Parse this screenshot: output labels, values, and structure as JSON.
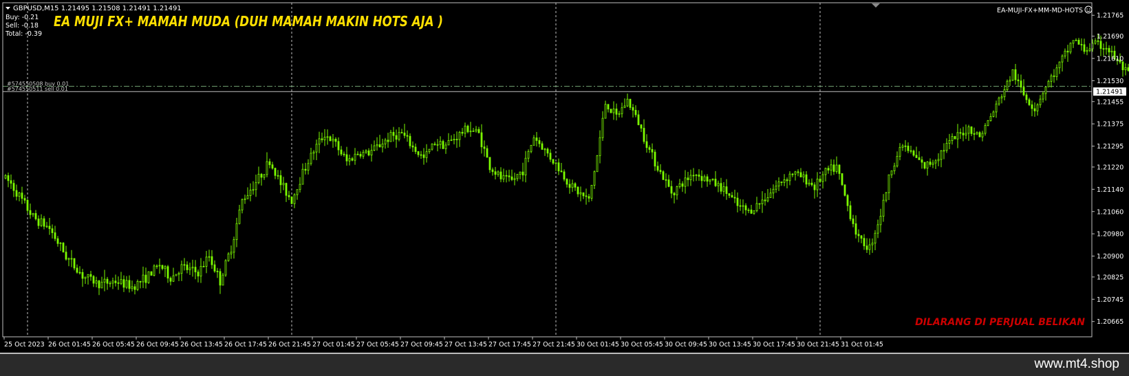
{
  "header": {
    "symbol_line": "GBPUSD,M15  1.21495 1.21508 1.21491 1.21491",
    "menu_icon": "triangle-down-icon",
    "buy": "Buy: -0.21",
    "sell": "Sell: -0.18",
    "total": "Total: -0.39",
    "title": "EA MUJI FX+ MAMAH MUDA  (DUH MAMAH MAKIN HOTS AJA )",
    "ea_name": "EA-MUJI-FX+MM-MD-HOTS",
    "ea_icon": "smiley-icon"
  },
  "watermark": "DILARANG DI PERJUAL BELIKAN",
  "footer": {
    "site": "www.mt4.shop"
  },
  "colors": {
    "background": "#000000",
    "candle": "#7CFC00",
    "grid": "#c0c0c0",
    "title": "#FFE000",
    "watermark": "#CC0000",
    "price_label_bg": "#FFFFFF",
    "order_buy": "#6E9E6E",
    "order_sell": "#C0C0C0"
  },
  "chart_data": {
    "type": "candlestick",
    "symbol": "GBPUSD",
    "timeframe": "M15",
    "ylim": [
      1.2061,
      1.2181
    ],
    "y_ticks": [
      "1.21765",
      "1.21690",
      "1.21610",
      "1.21530",
      "1.21455",
      "1.21375",
      "1.21295",
      "1.21220",
      "1.21140",
      "1.21060",
      "1.20980",
      "1.20900",
      "1.20825",
      "1.20745",
      "1.20665"
    ],
    "current_price": "1.21491",
    "x_labels": [
      "25 Oct 2023",
      "26 Oct 01:45",
      "26 Oct 05:45",
      "26 Oct 09:45",
      "26 Oct 13:45",
      "26 Oct 17:45",
      "26 Oct 21:45",
      "27 Oct 01:45",
      "27 Oct 05:45",
      "27 Oct 09:45",
      "27 Oct 13:45",
      "27 Oct 17:45",
      "27 Oct 21:45",
      "30 Oct 01:45",
      "30 Oct 05:45",
      "30 Oct 09:45",
      "30 Oct 13:45",
      "30 Oct 17:45",
      "30 Oct 21:45",
      "31 Oct 01:45"
    ],
    "candle_slots_per_label": 16,
    "day_separators_after_label": [
      0,
      6,
      12,
      18
    ],
    "orders": [
      {
        "label": "#574550508 buy 0.01",
        "price": 1.2151,
        "side": "buy"
      },
      {
        "label": "#574550511 sell 0.01",
        "price": 1.21491,
        "side": "sell"
      }
    ],
    "close_path": [
      [
        0,
        1.2118
      ],
      [
        2,
        1.2116
      ],
      [
        6,
        1.211
      ],
      [
        10,
        1.2104
      ],
      [
        16,
        1.21
      ],
      [
        22,
        1.209
      ],
      [
        28,
        1.2083
      ],
      [
        34,
        1.208
      ],
      [
        40,
        1.2081
      ],
      [
        46,
        1.2079
      ],
      [
        52,
        1.2083
      ],
      [
        56,
        1.2087
      ],
      [
        60,
        1.2082
      ],
      [
        64,
        1.2086
      ],
      [
        70,
        1.2084
      ],
      [
        74,
        1.209
      ],
      [
        78,
        1.2081
      ],
      [
        82,
        1.2093
      ],
      [
        86,
        1.211
      ],
      [
        92,
        1.2118
      ],
      [
        96,
        1.2124
      ],
      [
        100,
        1.2116
      ],
      [
        104,
        1.211
      ],
      [
        108,
        1.212
      ],
      [
        112,
        1.2128
      ],
      [
        116,
        1.2134
      ],
      [
        120,
        1.213
      ],
      [
        124,
        1.2124
      ],
      [
        128,
        1.2127
      ],
      [
        132,
        1.2127
      ],
      [
        136,
        1.213
      ],
      [
        140,
        1.2133
      ],
      [
        144,
        1.2134
      ],
      [
        148,
        1.2129
      ],
      [
        152,
        1.2125
      ],
      [
        156,
        1.2131
      ],
      [
        160,
        1.213
      ],
      [
        164,
        1.2133
      ],
      [
        168,
        1.2136
      ],
      [
        172,
        1.2134
      ],
      [
        176,
        1.2122
      ],
      [
        180,
        1.2118
      ],
      [
        184,
        1.2117
      ],
      [
        188,
        1.2121
      ],
      [
        192,
        1.2133
      ],
      [
        196,
        1.2128
      ],
      [
        200,
        1.2123
      ],
      [
        204,
        1.2117
      ],
      [
        208,
        1.2113
      ],
      [
        212,
        1.211
      ],
      [
        215,
        1.2126
      ],
      [
        218,
        1.2145
      ],
      [
        222,
        1.214
      ],
      [
        226,
        1.2146
      ],
      [
        230,
        1.2138
      ],
      [
        234,
        1.2128
      ],
      [
        238,
        1.212
      ],
      [
        242,
        1.2113
      ],
      [
        246,
        1.2116
      ],
      [
        250,
        1.212
      ],
      [
        254,
        1.2118
      ],
      [
        258,
        1.2116
      ],
      [
        262,
        1.2113
      ],
      [
        266,
        1.2108
      ],
      [
        270,
        1.2106
      ],
      [
        274,
        1.2109
      ],
      [
        278,
        1.2113
      ],
      [
        282,
        1.2117
      ],
      [
        286,
        1.212
      ],
      [
        290,
        1.2118
      ],
      [
        294,
        1.2115
      ],
      [
        298,
        1.212
      ],
      [
        302,
        1.2122
      ],
      [
        306,
        1.2108
      ],
      [
        310,
        1.2096
      ],
      [
        314,
        1.2093
      ],
      [
        318,
        1.2105
      ],
      [
        322,
        1.2122
      ],
      [
        326,
        1.213
      ],
      [
        330,
        1.2126
      ],
      [
        334,
        1.2122
      ],
      [
        338,
        1.2125
      ],
      [
        342,
        1.213
      ],
      [
        346,
        1.2133
      ],
      [
        350,
        1.2136
      ],
      [
        354,
        1.2133
      ],
      [
        358,
        1.214
      ],
      [
        362,
        1.2148
      ],
      [
        366,
        1.2156
      ],
      [
        370,
        1.2148
      ],
      [
        374,
        1.2143
      ],
      [
        378,
        1.2151
      ],
      [
        382,
        1.2157
      ],
      [
        386,
        1.2164
      ],
      [
        388,
        1.2168
      ],
      [
        392,
        1.2164
      ],
      [
        396,
        1.2166
      ],
      [
        400,
        1.2165
      ],
      [
        404,
        1.216
      ],
      [
        408,
        1.2155
      ],
      [
        412,
        1.2151
      ],
      [
        414,
        1.2149
      ]
    ]
  }
}
